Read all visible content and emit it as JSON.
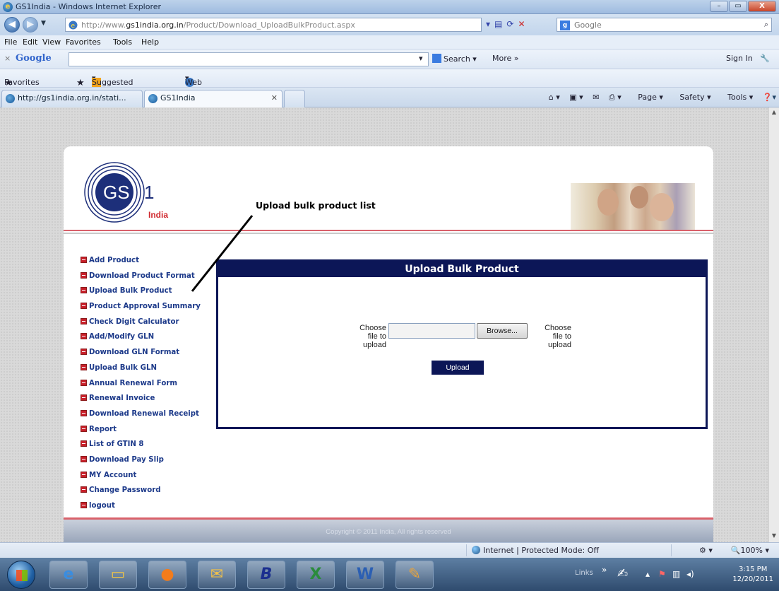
{
  "window": {
    "title": "GS1India - Windows Internet Explorer",
    "buttons": {
      "minimize": "–",
      "maximize": "▭",
      "close": "X"
    }
  },
  "address_bar": {
    "url_prefix": "http://www.",
    "url_domain": "gs1india.org.in",
    "url_path": "/Product/Download_UploadBulkProduct.aspx",
    "search_provider": "Google",
    "search_placeholder": "Google"
  },
  "menu": [
    "File",
    "Edit",
    "View",
    "Favorites",
    "Tools",
    "Help"
  ],
  "google_toolbar": {
    "logo": "Google",
    "search_label": "Search",
    "more_label": "More »",
    "signin_label": "Sign In"
  },
  "favorites_bar": {
    "favorites_label": "Favorites",
    "suggested_sites": "Suggested Sites",
    "web_slice_gallery": "Web Slice Gallery"
  },
  "tabs": [
    {
      "label": "http://gs1india.org.in/stati..."
    },
    {
      "label": "GS1India"
    }
  ],
  "command_bar": {
    "page": "Page",
    "safety": "Safety",
    "tools": "Tools"
  },
  "page": {
    "logo_text": "GS1",
    "logo_sub": "India",
    "annotation": "Upload bulk product list",
    "sidebar_items": [
      "Add Product",
      "Download Product Format",
      "Upload Bulk Product",
      "Product Approval Summary",
      "Check Digit Calculator",
      "Add/Modify GLN",
      "Download GLN Format",
      "Upload Bulk GLN",
      "Annual Renewal Form",
      "Renewal Invoice",
      "Download Renewal Receipt",
      "Report",
      "List of GTIN 8",
      "Download Pay Slip",
      "MY Account",
      "Change Password",
      "logout"
    ],
    "panel": {
      "title": "Upload Bulk Product",
      "choose_label_left": [
        "Choose",
        "file to",
        "upload"
      ],
      "choose_label_right": [
        "Choose",
        "file to",
        "upload"
      ],
      "file_value": "",
      "browse_label": "Browse...",
      "upload_label": "Upload"
    },
    "footer": "Copyright © 2011 India, All rights reserved"
  },
  "status_bar": {
    "zone": "Internet | Protected Mode: Off",
    "zoom": "100%"
  },
  "taskbar": {
    "clock_time": "3:15 PM",
    "clock_date": "12/20/2011",
    "tray_links": "Links"
  },
  "colors": {
    "navy": "#0c1657",
    "link_blue": "#1d3a8a",
    "accent_red": "#d0282e"
  }
}
